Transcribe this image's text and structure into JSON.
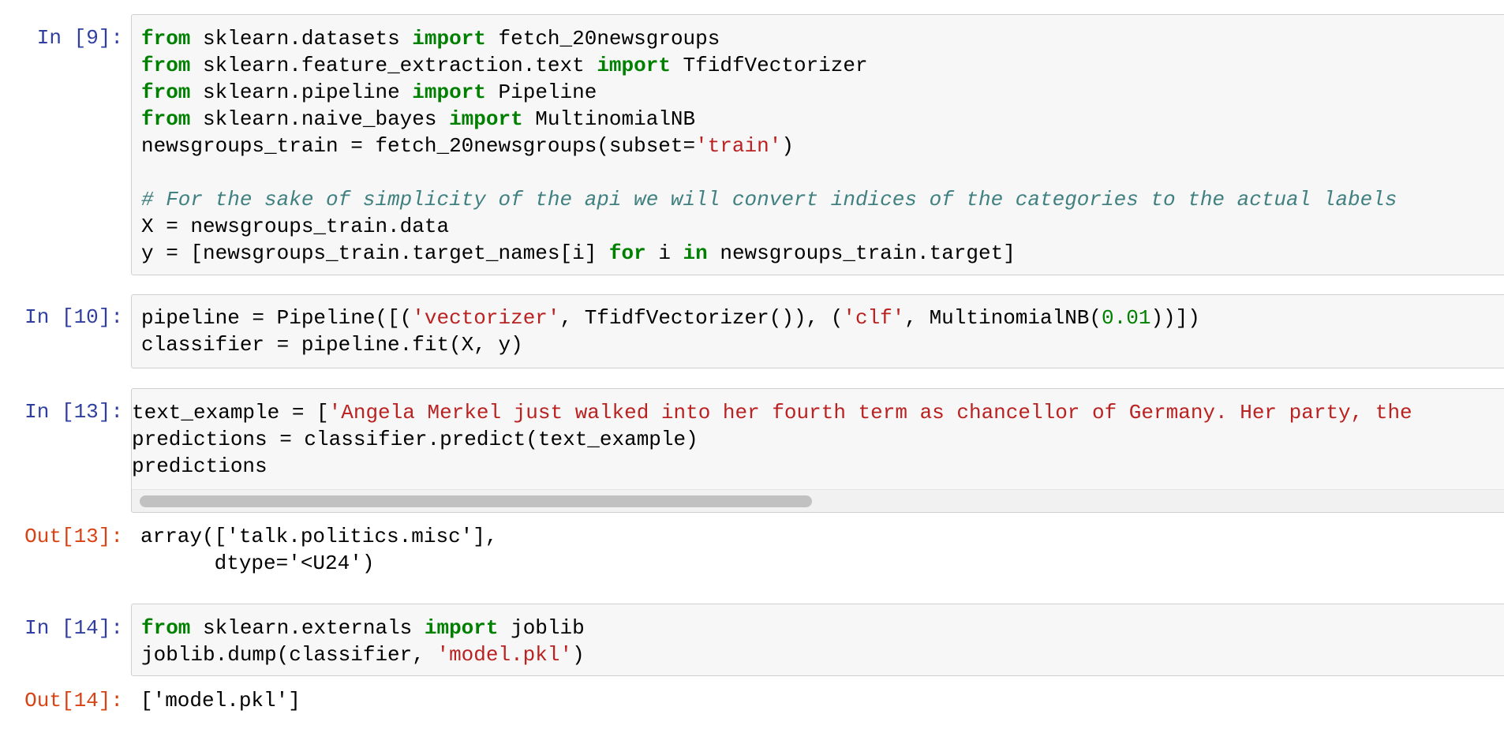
{
  "cells": [
    {
      "prompt": "In [9]:",
      "lines": [
        [
          [
            "kw",
            "from"
          ],
          [
            "p",
            " sklearn.datasets "
          ],
          [
            "kw",
            "import"
          ],
          [
            "p",
            " fetch_20newsgroups"
          ]
        ],
        [
          [
            "kw",
            "from"
          ],
          [
            "p",
            " sklearn.feature_extraction.text "
          ],
          [
            "kw",
            "import"
          ],
          [
            "p",
            " TfidfVectorizer"
          ]
        ],
        [
          [
            "kw",
            "from"
          ],
          [
            "p",
            " sklearn.pipeline "
          ],
          [
            "kw",
            "import"
          ],
          [
            "p",
            " Pipeline"
          ]
        ],
        [
          [
            "kw",
            "from"
          ],
          [
            "p",
            " sklearn.naive_bayes "
          ],
          [
            "kw",
            "import"
          ],
          [
            "p",
            " MultinomialNB"
          ]
        ],
        [
          [
            "p",
            "newsgroups_train = fetch_20newsgroups(subset="
          ],
          [
            "str",
            "'train'"
          ],
          [
            "p",
            ")"
          ]
        ],
        [],
        [
          [
            "cmt",
            "# For the sake of simplicity of the api we will convert indices of the categories to the actual labels"
          ]
        ],
        [
          [
            "p",
            "X = newsgroups_train.data"
          ]
        ],
        [
          [
            "p",
            "y = [newsgroups_train.target_names[i] "
          ],
          [
            "kw",
            "for"
          ],
          [
            "p",
            " i "
          ],
          [
            "kw",
            "in"
          ],
          [
            "p",
            " newsgroups_train.target]"
          ]
        ]
      ]
    },
    {
      "prompt": "In [10]:",
      "lines": [
        [
          [
            "p",
            "pipeline = Pipeline([("
          ],
          [
            "str",
            "'vectorizer'"
          ],
          [
            "p",
            ", TfidfVectorizer()), ("
          ],
          [
            "str",
            "'clf'"
          ],
          [
            "p",
            ", MultinomialNB("
          ],
          [
            "num",
            "0.01"
          ],
          [
            "p",
            "))])"
          ]
        ],
        [
          [
            "p",
            "classifier = pipeline.fit(X, y)"
          ]
        ]
      ]
    },
    {
      "prompt": "In [13]:",
      "lines": [
        [
          [
            "p",
            "text_example = ["
          ],
          [
            "str",
            "'Angela Merkel just walked into her fourth term as chancellor of Germany. Her party, the"
          ]
        ],
        [
          [
            "p",
            "predictions = classifier.predict(text_example)"
          ]
        ],
        [
          [
            "p",
            "predictions"
          ]
        ]
      ],
      "scrollbar": {
        "visible_fraction": 0.49
      }
    },
    {
      "prompt": "Out[13]:",
      "lines": [
        [
          [
            "p",
            "array(['talk.politics.misc'],"
          ]
        ],
        [
          [
            "p",
            "      dtype='<U24')"
          ]
        ]
      ]
    },
    {
      "prompt": "In [14]:",
      "lines": [
        [
          [
            "kw",
            "from"
          ],
          [
            "p",
            " sklearn.externals "
          ],
          [
            "kw",
            "import"
          ],
          [
            "p",
            " joblib"
          ]
        ],
        [
          [
            "p",
            "joblib.dump(classifier, "
          ],
          [
            "str",
            "'model.pkl'"
          ],
          [
            "p",
            ")"
          ]
        ]
      ]
    },
    {
      "prompt": "Out[14]:",
      "lines": [
        [
          [
            "p",
            "['model.pkl']"
          ]
        ]
      ]
    }
  ]
}
